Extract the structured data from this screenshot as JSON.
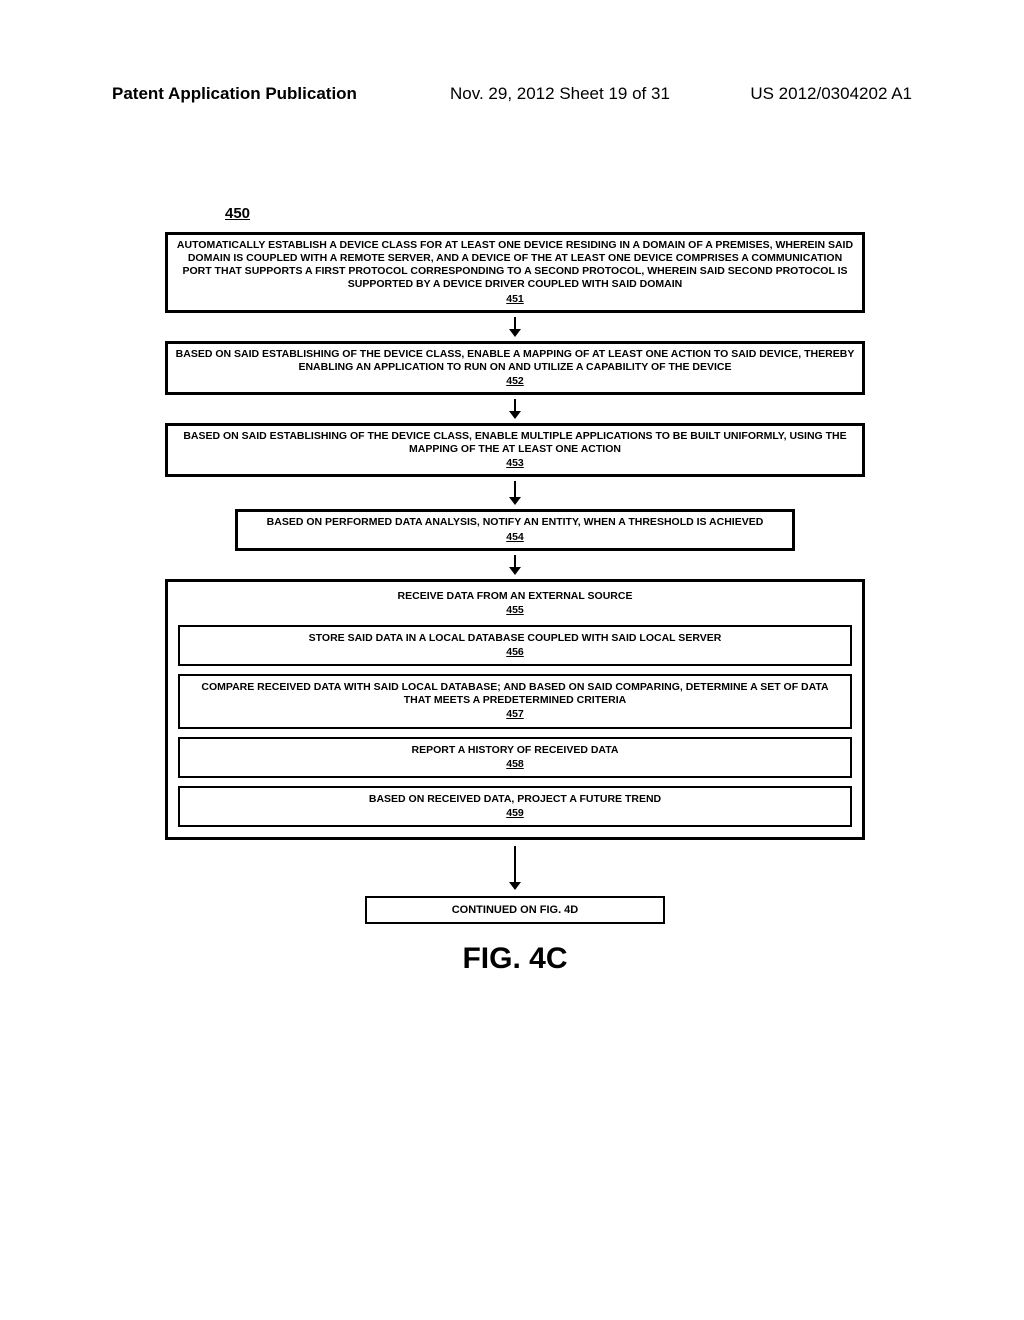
{
  "header": {
    "left": "Patent Application Publication",
    "mid": "Nov. 29, 2012  Sheet 19 of 31",
    "right": "US 2012/0304202 A1"
  },
  "figure": {
    "number": "450",
    "caption": "FIG. 4C",
    "continued": "CONTINUED ON FIG. 4D"
  },
  "boxes": {
    "b451": {
      "text": "AUTOMATICALLY ESTABLISH A DEVICE CLASS FOR AT LEAST ONE DEVICE RESIDING IN A DOMAIN OF A PREMISES, WHEREIN SAID DOMAIN IS COUPLED WITH A REMOTE SERVER, AND A DEVICE OF THE AT LEAST ONE DEVICE COMPRISES A COMMUNICATION PORT THAT SUPPORTS A FIRST PROTOCOL CORRESPONDING TO A SECOND PROTOCOL, WHEREIN SAID SECOND PROTOCOL IS SUPPORTED BY A DEVICE DRIVER COUPLED WITH SAID DOMAIN",
      "ref": "451"
    },
    "b452": {
      "text": "BASED ON SAID ESTABLISHING OF THE DEVICE CLASS, ENABLE A MAPPING OF AT LEAST ONE ACTION TO SAID DEVICE, THEREBY ENABLING AN APPLICATION TO RUN ON AND UTILIZE A CAPABILITY OF THE DEVICE",
      "ref": "452"
    },
    "b453": {
      "text": "BASED ON SAID ESTABLISHING OF THE DEVICE CLASS, ENABLE MULTIPLE APPLICATIONS TO BE BUILT UNIFORMLY, USING THE MAPPING OF THE AT LEAST ONE ACTION",
      "ref": "453"
    },
    "b454": {
      "text": "BASED ON PERFORMED DATA ANALYSIS, NOTIFY AN ENTITY, WHEN A THRESHOLD IS ACHIEVED",
      "ref": "454"
    },
    "b455": {
      "text": "RECEIVE DATA FROM AN EXTERNAL SOURCE",
      "ref": "455"
    },
    "b456": {
      "text": "STORE SAID DATA IN A LOCAL DATABASE COUPLED WITH SAID LOCAL SERVER",
      "ref": "456"
    },
    "b457": {
      "text": "COMPARE RECEIVED DATA WITH SAID LOCAL DATABASE; AND BASED ON SAID COMPARING, DETERMINE A SET OF DATA THAT MEETS A PREDETERMINED CRITERIA",
      "ref": "457"
    },
    "b458": {
      "text": "REPORT A HISTORY OF RECEIVED DATA",
      "ref": "458"
    },
    "b459": {
      "text": "BASED ON RECEIVED DATA, PROJECT A FUTURE TREND",
      "ref": "459"
    }
  }
}
